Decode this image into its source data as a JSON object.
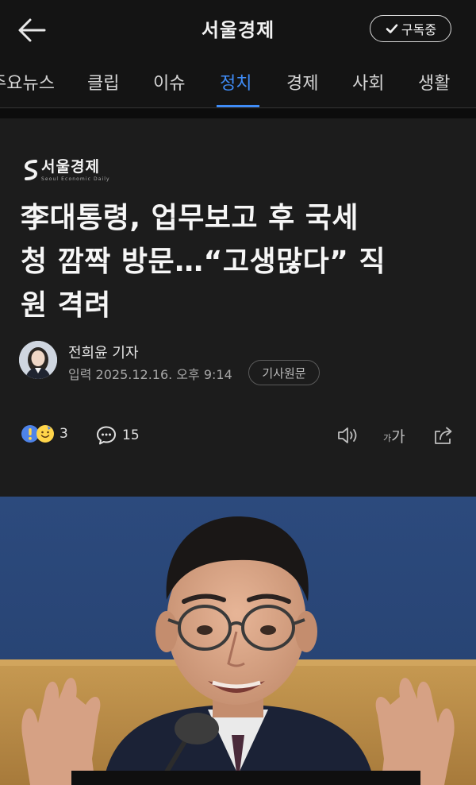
{
  "header": {
    "title": "서울경제",
    "subscribe_label": "구독중",
    "icons": {
      "back": "arrow-left-icon",
      "subscribe": "check-icon"
    }
  },
  "tabs": [
    {
      "label": "주요뉴스"
    },
    {
      "label": "클립"
    },
    {
      "label": "이슈"
    },
    {
      "label": "정치",
      "active": true
    },
    {
      "label": "경제"
    },
    {
      "label": "사회"
    },
    {
      "label": "생활"
    }
  ],
  "article": {
    "logo": {
      "name": "서울경제",
      "sub": "Seoul Economic Daily"
    },
    "headline_lines": [
      "李대통령, 업무보고 후 국세",
      "청 깜짝 방문…“고생많다” 직",
      "원 격려"
    ],
    "reporter": "전희윤 기자",
    "published": "입력 2025.12.16. 오후 9:14",
    "source_button": "기사원문",
    "reaction_count": "3",
    "comment_count": "15",
    "tools": {
      "tts": "speaker-icon",
      "font_small": "가",
      "font_big": "가",
      "share": "share-icon"
    }
  },
  "colors": {
    "background": "#141414",
    "article_bg": "#1c1c1c",
    "accent": "#3f8cf7",
    "text": "#f0f0f0",
    "muted": "#a9a9a9"
  }
}
